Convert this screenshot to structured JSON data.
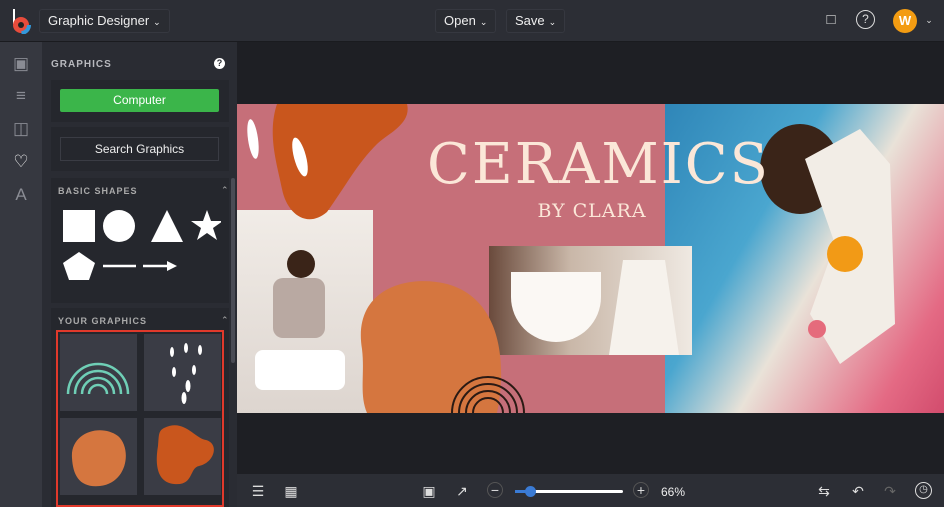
{
  "header": {
    "app_menu": "Graphic Designer",
    "open": "Open",
    "save": "Save",
    "avatar_initial": "W"
  },
  "panel": {
    "title": "GRAPHICS",
    "source_button": "Computer",
    "search_button": "Search Graphics",
    "basic_shapes": "BASIC SHAPES",
    "your_graphics": "YOUR GRAPHICS"
  },
  "design": {
    "title": "CERAMICS",
    "subtitle": "BY CLARA"
  },
  "footer": {
    "zoom": "66%",
    "zoom_fraction": 0.12
  },
  "colors": {
    "accent_green": "#3bb54a",
    "avatar": "#f39c12",
    "selection": "#e0392b",
    "pink": "#c66f79",
    "orange": "#d5763f"
  }
}
